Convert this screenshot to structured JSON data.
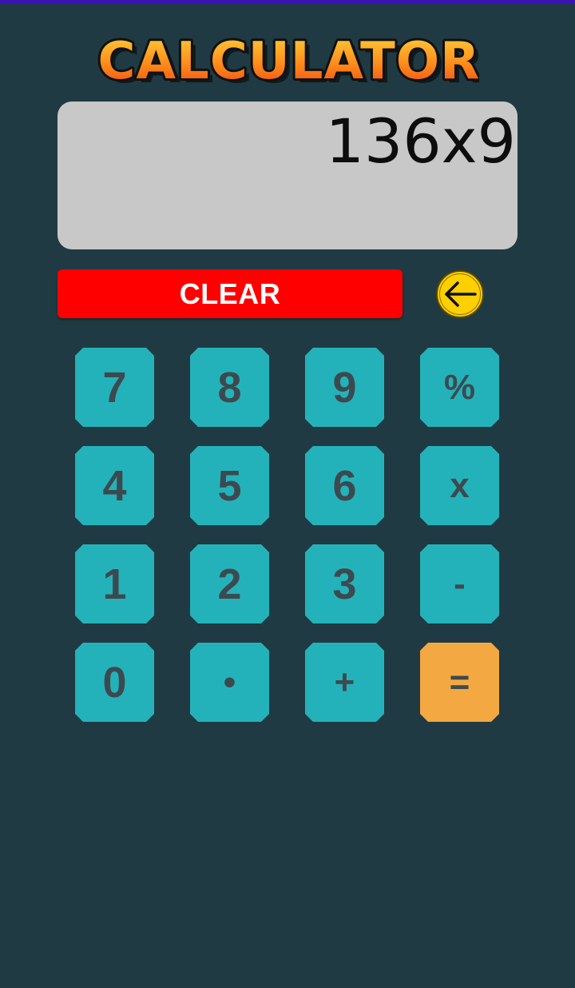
{
  "app": {
    "title": "CALCULATOR"
  },
  "display": {
    "value": "136x9"
  },
  "controls": {
    "clear_label": "CLEAR",
    "backspace_icon": "arrow-left-circle-icon"
  },
  "keypad": {
    "rows": [
      [
        "7",
        "8",
        "9",
        "%"
      ],
      [
        "4",
        "5",
        "6",
        "x"
      ],
      [
        "1",
        "2",
        "3",
        "-"
      ],
      [
        "0",
        "•",
        "+",
        "="
      ]
    ]
  },
  "colors": {
    "background": "#203a43",
    "display": "#c8c8c8",
    "clear": "#ff0000",
    "key": "#24b2ba",
    "equals": "#f4a842",
    "backspace": "#ffd000"
  }
}
